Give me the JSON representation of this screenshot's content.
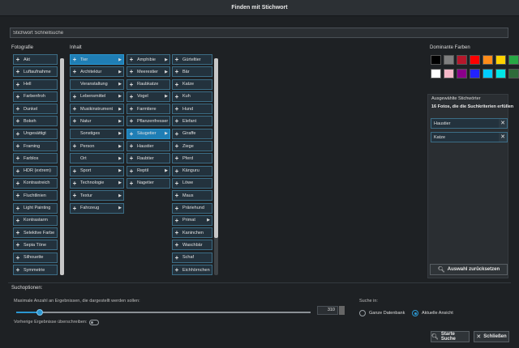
{
  "window": {
    "title": "Finden mit Stichwort"
  },
  "search": {
    "value": "Stichwort Schnellsuche"
  },
  "columns": {
    "fotografie_label": "Fotografie",
    "inhalt_label": "Inhalt",
    "fotografie": [
      "Akt",
      "Luftaufnahme",
      "Hell",
      "Farbenfroh",
      "Dunkel",
      "Bokeh",
      "Ungesättigt",
      "Framing",
      "Farblos",
      "HDR (extrem)",
      "Kontrastreich",
      "Fluchtlinien",
      "Light Painting",
      "Kontrastarm",
      "Selektive Farbe",
      "Sepia Töne",
      "Silhouette",
      "Symmetrie"
    ],
    "inhalt": [
      {
        "label": "Tier",
        "plus": true,
        "arrow": true,
        "selected": true
      },
      {
        "label": "Architektur",
        "plus": true,
        "arrow": true
      },
      {
        "label": "Veranstaltung",
        "plus": false,
        "arrow": true
      },
      {
        "label": "Lebensmittel",
        "plus": true,
        "arrow": true
      },
      {
        "label": "Musikinstrument",
        "plus": true,
        "arrow": true
      },
      {
        "label": "Natur",
        "plus": true,
        "arrow": true
      },
      {
        "label": "Sonstiges",
        "plus": false,
        "arrow": true
      },
      {
        "label": "Person",
        "plus": true,
        "arrow": true
      },
      {
        "label": "Ort",
        "plus": false,
        "arrow": true
      },
      {
        "label": "Sport",
        "plus": true,
        "arrow": true
      },
      {
        "label": "Technologie",
        "plus": true,
        "arrow": true
      },
      {
        "label": "Textur",
        "plus": true,
        "arrow": true
      },
      {
        "label": "Fahrzeug",
        "plus": true,
        "arrow": true
      }
    ],
    "tier": [
      {
        "label": "Amphibie",
        "arrow": true
      },
      {
        "label": "Meerestier",
        "arrow": true
      },
      {
        "label": "Raubkatze",
        "arrow": false
      },
      {
        "label": "Vogel",
        "arrow": true
      },
      {
        "label": "Farmtiere",
        "arrow": false
      },
      {
        "label": "Pflanzenfresser",
        "arrow": false
      },
      {
        "label": "Säugetier",
        "arrow": true,
        "selected": true
      },
      {
        "label": "Haustier",
        "arrow": false
      },
      {
        "label": "Raubtier",
        "arrow": false
      },
      {
        "label": "Reptil",
        "arrow": true
      },
      {
        "label": "Nagetier",
        "arrow": false
      }
    ],
    "saeugetier": [
      {
        "label": "Gürteltier"
      },
      {
        "label": "Bär"
      },
      {
        "label": "Katze"
      },
      {
        "label": "Kuh"
      },
      {
        "label": "Hund"
      },
      {
        "label": "Elefant"
      },
      {
        "label": "Giraffe"
      },
      {
        "label": "Ziege"
      },
      {
        "label": "Pferd"
      },
      {
        "label": "Känguru"
      },
      {
        "label": "Löwe"
      },
      {
        "label": "Maus"
      },
      {
        "label": "Präriehund"
      },
      {
        "label": "Primat",
        "arrow": true
      },
      {
        "label": "Kaninchen"
      },
      {
        "label": "Waschbär"
      },
      {
        "label": "Schaf"
      },
      {
        "label": "Eichhörnchen"
      }
    ]
  },
  "colors": {
    "label": "Dominante Farben",
    "swatches": [
      "#000000",
      "#7f7f7f",
      "#b5172b",
      "#ff0000",
      "#ff8c1a",
      "#ffd200",
      "#27a844",
      "#ffffff",
      "#f5b8c8",
      "#8b008b",
      "#2222ff",
      "#00ccff",
      "#00e6e6",
      "#2f6b3a"
    ]
  },
  "selected_keywords": {
    "label": "Ausgewählte Stichwörter",
    "summary": "16 Fotos, die die Suchkriterien erfüllen",
    "items": [
      "Haustier",
      "Katze"
    ],
    "reset_label": "Auswahl zurücksetzen"
  },
  "options": {
    "label": "Suchoptionen:",
    "max_results_label": "Maximale Anzahl an Ergebnissen, die dargestellt werden sollen:",
    "max_results_value": "310",
    "slider_fraction": 0.08,
    "overwrite_label": "Vorherige Ergebnisse überschreiben:",
    "search_in_label": "Suche in:",
    "radio_all": "Ganze Datenbank",
    "radio_current": "Aktuelle Ansicht"
  },
  "buttons": {
    "start": "Starte Suche",
    "close": "Schließen"
  }
}
